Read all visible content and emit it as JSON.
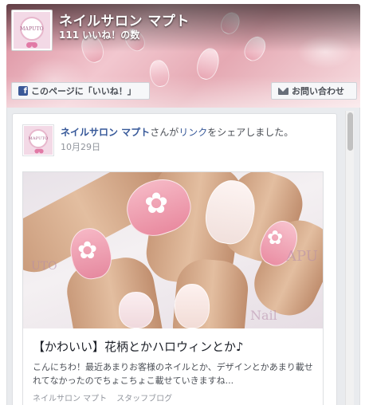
{
  "header": {
    "page_name": "ネイルサロン マプト",
    "likes_text": "111 いいね！の数",
    "logo_text": "MAPUTO",
    "like_button_label": "このページに「いいね！」",
    "like_button_icon": "facebook-icon",
    "contact_button_label": "お問い合わせ",
    "contact_button_icon": "envelope-icon"
  },
  "post": {
    "author": "ネイルサロン マプト",
    "action_prefix": "さんが",
    "link_word": "リンク",
    "action_suffix": "をシェアしました。",
    "date": "10月29日",
    "share": {
      "title": "【かわいい】花柄とかハロウィンとか♪",
      "description": "こんにちわ！最近あまりお客様のネイルとか、デザインとかあまり載せれてなかったのでちょこちょこ載せていきますね...",
      "source_name": "ネイルサロン マプト",
      "source_category": "スタッフブログ"
    }
  },
  "colors": {
    "facebook_blue": "#3b5998",
    "link_blue": "#365899",
    "timeline_bg": "#e9ebee"
  }
}
